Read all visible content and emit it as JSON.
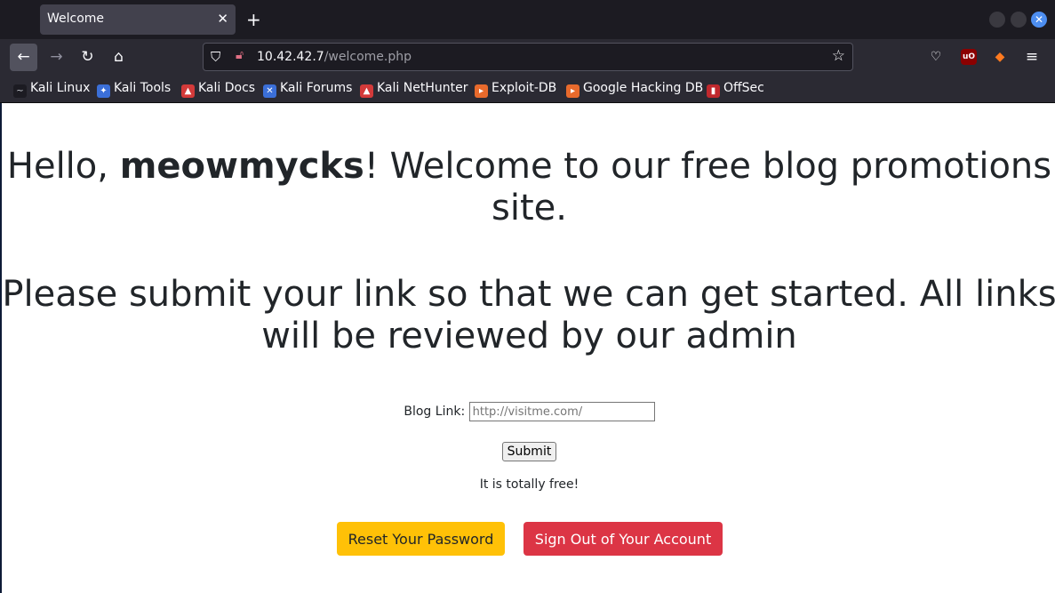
{
  "browser": {
    "tab_title": "Welcome",
    "tab_close": "✕",
    "new_tab": "+",
    "url_host": "10.42.42.7",
    "url_path": "/welcome.php",
    "ublock_label": "uO",
    "bookmarks": [
      {
        "label": "Kali Linux",
        "icon": "kali-dragon-icon",
        "color": "#1c1b22"
      },
      {
        "label": "Kali Tools",
        "icon": "kali-tools-icon",
        "color": "#3b6fd8"
      },
      {
        "label": "Kali Docs",
        "icon": "kali-docs-icon",
        "color": "#d33a3a"
      },
      {
        "label": "Kali Forums",
        "icon": "kali-forums-icon",
        "color": "#3b6fd8"
      },
      {
        "label": "Kali NetHunter",
        "icon": "kali-nethunter-icon",
        "color": "#d33a3a"
      },
      {
        "label": "Exploit-DB",
        "icon": "exploit-db-icon",
        "color": "#e86a2c"
      },
      {
        "label": "Google Hacking DB",
        "icon": "ghdb-icon",
        "color": "#e86a2c"
      },
      {
        "label": "OffSec",
        "icon": "offsec-icon",
        "color": "#c0282d"
      }
    ]
  },
  "page": {
    "greeting_prefix": "Hello, ",
    "username": "meowmycks",
    "greeting_suffix": "! Welcome to our free blog promotions site.",
    "instruction": "Please submit your link so that we can get started. All links will be reviewed by our admin",
    "blog_label": "Blog Link:",
    "blog_placeholder": "http://visitme.com/",
    "submit_label": "Submit",
    "free_note": "It is totally free!",
    "reset_label": "Reset Your Password",
    "signout_label": "Sign Out of Your Account"
  },
  "colors": {
    "reset_button": "#ffc107",
    "signout_button": "#dc3545",
    "text": "#212529"
  }
}
